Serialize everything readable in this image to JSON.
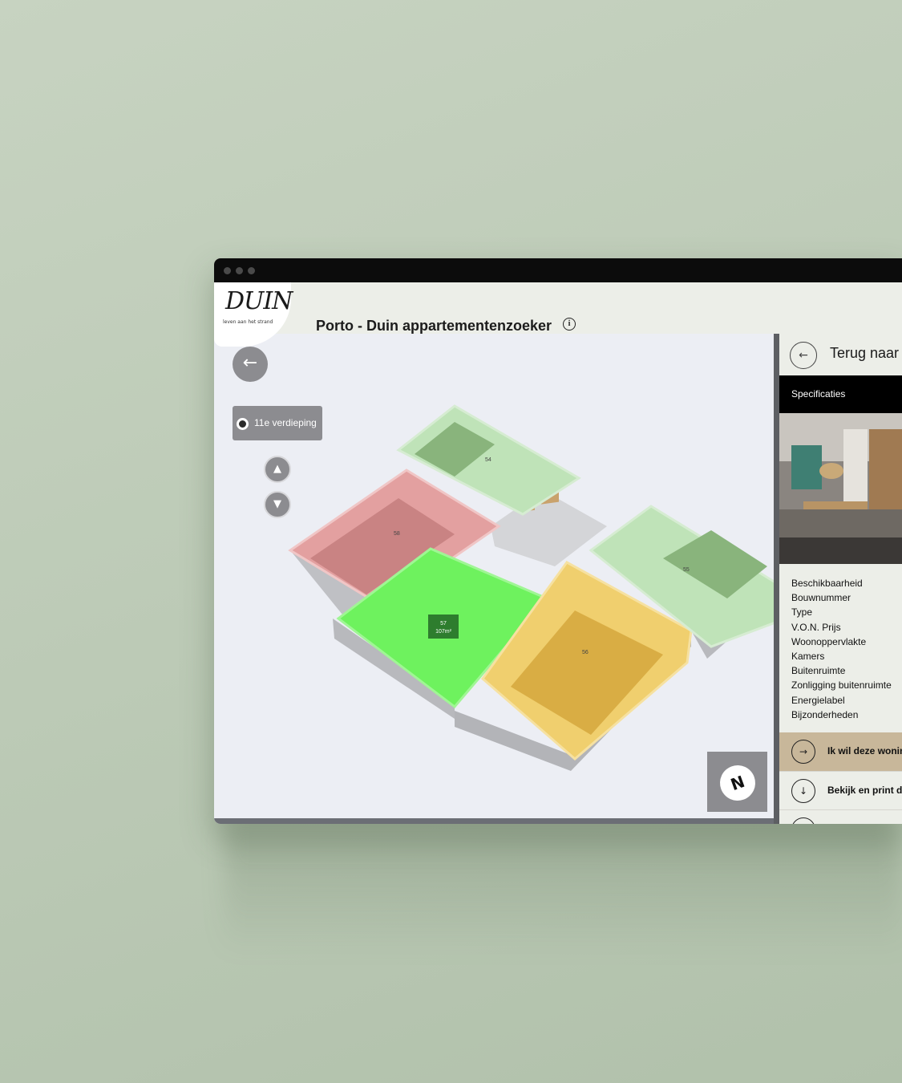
{
  "app": {
    "logo_text": "DUIN",
    "logo_tagline": "leven aan het strand",
    "title": "Porto - Duin appartementenzoeker",
    "info_icon": "info-icon"
  },
  "viewer": {
    "back_icon": "arrow-left-icon",
    "floor_selector": {
      "label": "11e verdieping"
    },
    "floor_up_icon": "triangle-up-icon",
    "floor_down_icon": "triangle-down-icon",
    "units": [
      {
        "number": "54",
        "status_color": "#bfe3b8"
      },
      {
        "number": "58",
        "status_color": "#e3a0a0"
      },
      {
        "number": "57",
        "area": "107m²",
        "status_color": "#6ef25e",
        "selected": true
      },
      {
        "number": "56",
        "status_color": "#f0cf6e"
      },
      {
        "number": "55",
        "status_color": "#bfe3b8"
      }
    ],
    "compass": {
      "letter": "N",
      "icon": "compass-icon"
    }
  },
  "sidebar": {
    "back_label": "Terug naar",
    "back_icon": "arrow-left-icon",
    "tab": "Specificaties",
    "specs": [
      "Beschikbaarheid",
      "Bouwnummer",
      "Type",
      "V.O.N. Prijs",
      "Woonoppervlakte",
      "Kamers",
      "Buitenruimte",
      "Zonligging buitenruimte",
      "Energielabel",
      "Bijzonderheden"
    ],
    "actions": [
      {
        "label": "Ik wil deze woning",
        "icon": "arrow-right-icon",
        "bg": "#c8b79a"
      },
      {
        "label": "Bekijk en print de",
        "icon": "arrow-down-icon",
        "bg": "#eceee8"
      }
    ]
  },
  "colors": {
    "accent": "#c8b79a",
    "available": "#6ef25e",
    "sold": "#e3a0a0",
    "reserved": "#f0cf6e"
  }
}
